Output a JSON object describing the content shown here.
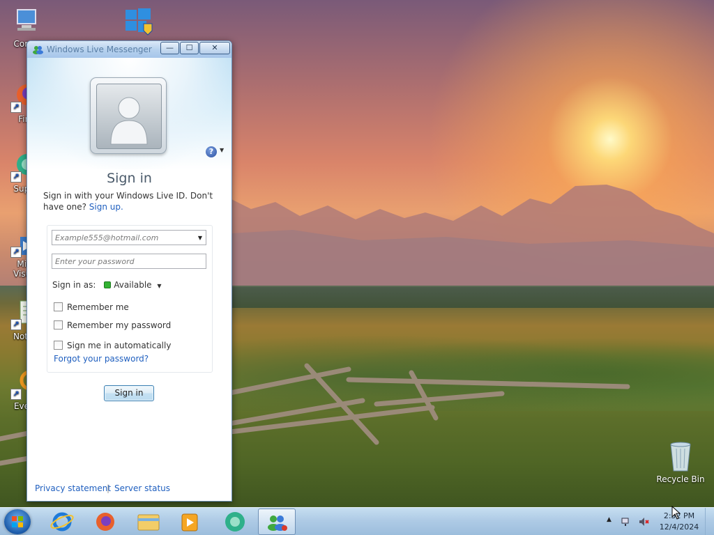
{
  "desktop": {
    "icons": [
      {
        "label": "Comp",
        "icon": "computer-icon"
      },
      {
        "label": "Fire",
        "icon": "firefox-icon"
      },
      {
        "label": "Super",
        "icon": "app-icon"
      },
      {
        "label": "Micr",
        "label2": "Visual",
        "icon": "visual-studio-icon"
      },
      {
        "label": "Notep",
        "icon": "notepad-icon"
      },
      {
        "label": "Every",
        "icon": "everything-icon"
      }
    ],
    "recycle_bin": "Recycle Bin"
  },
  "window": {
    "title": "Windows Live Messenger",
    "controls": {
      "minimize": "—",
      "maximize": "☐",
      "close": "✕"
    },
    "help_label": "?",
    "heading": "Sign in",
    "intro_text": "Sign in with your Windows Live ID. Don't have one?",
    "signup_link": "Sign up.",
    "email_placeholder": "Example555@hotmail.com",
    "password_placeholder": "Enter your password",
    "sign_in_as_label": "Sign in as:",
    "status_value": "Available",
    "checkboxes": [
      {
        "label": "Remember me",
        "checked": false
      },
      {
        "label": "Remember my password",
        "checked": false
      },
      {
        "label": "Sign me in automatically",
        "checked": false
      }
    ],
    "forgot_link": "Forgot your password?",
    "signin_button": "Sign in",
    "footer": {
      "privacy": "Privacy statement",
      "server_status": "Server status"
    }
  },
  "taskbar": {
    "pinned": [
      "internet-explorer-icon",
      "firefox-icon",
      "file-explorer-icon",
      "media-player-icon",
      "app-icon",
      "messenger-icon"
    ],
    "clock_time": "2:52 PM",
    "clock_date": "12/4/2024"
  },
  "colors": {
    "link": "#1f5fbf",
    "available": "#33b233",
    "title": "#5b7fa6"
  }
}
